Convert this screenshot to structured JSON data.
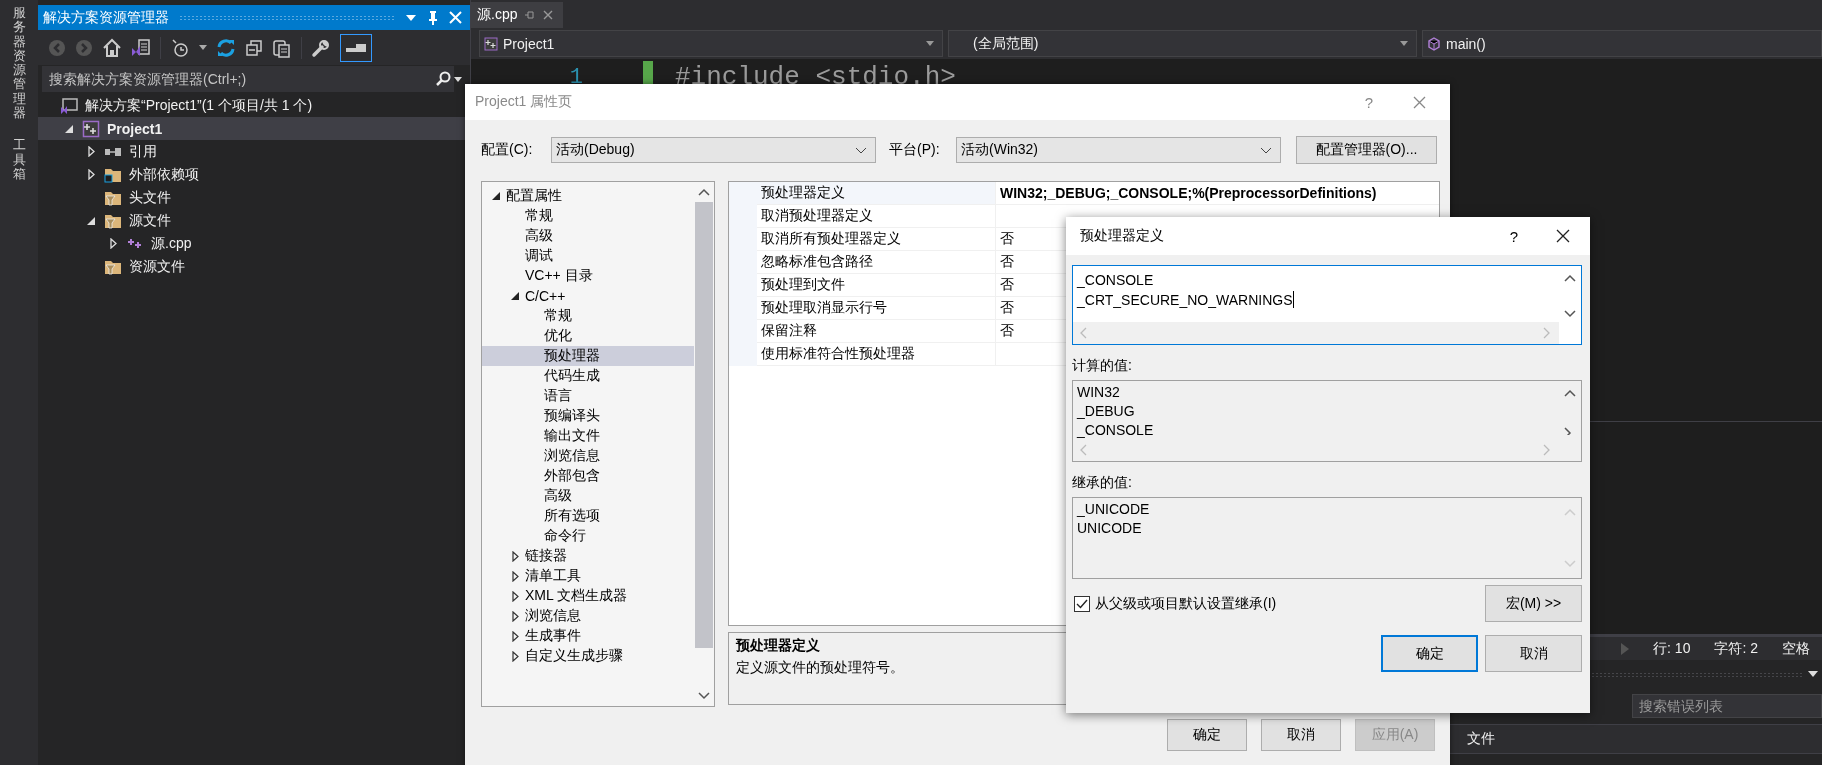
{
  "side_tabs": [
    {
      "label": "服务器资源管理器"
    },
    {
      "label": "工具箱"
    }
  ],
  "solution_explorer": {
    "title": "解决方案资源管理器",
    "preview_toggle": {
      "on": true
    },
    "search": {
      "placeholder": "搜索解决方案资源管理器(Ctrl+;)"
    },
    "tree": [
      {
        "label": "解决方案“Project1”(1 个项目/共 1 个)",
        "kind": "solution",
        "selected": false,
        "children": [
          {
            "label": "Project1",
            "kind": "project",
            "expanded": true,
            "selected": true,
            "children": [
              {
                "label": "引用",
                "kind": "references",
                "expanded": false,
                "selected": false
              },
              {
                "label": "外部依赖项",
                "kind": "external",
                "expanded": false,
                "selected": false
              },
              {
                "label": "头文件",
                "kind": "filter",
                "selected": false
              },
              {
                "label": "源文件",
                "kind": "filter",
                "expanded": true,
                "selected": false,
                "children": [
                  {
                    "label": "源.cpp",
                    "kind": "cpp",
                    "expanded": false,
                    "selected": false
                  }
                ]
              },
              {
                "label": "资源文件",
                "kind": "filter",
                "selected": false
              }
            ]
          }
        ]
      }
    ]
  },
  "editor": {
    "tab": {
      "label": "源.cpp",
      "selected": true
    },
    "nav": [
      {
        "label": "Project1",
        "kind": "project"
      },
      {
        "label": "(全局范围)",
        "kind": "scope"
      },
      {
        "label": "main()",
        "kind": "function"
      }
    ],
    "code": [
      {
        "number": "1",
        "text": "#include <stdio.h>"
      }
    ],
    "status_bar": [
      "行: 10",
      "字符: 2",
      "空格"
    ],
    "error_list": {
      "search": {
        "placeholder": "搜索错误列表"
      },
      "columns": [
        "文件"
      ]
    }
  },
  "properties": {
    "title": "Project1 属性页",
    "help": "?",
    "configuration": {
      "label": "配置(C):",
      "value": "活动(Debug)"
    },
    "platform": {
      "label": "平台(P):",
      "value": "活动(Win32)"
    },
    "manager_button": "配置管理器(O)...",
    "tree": [
      {
        "label": "配置属性",
        "expanded": true,
        "selected": false,
        "children": [
          {
            "label": "常规",
            "selected": false
          },
          {
            "label": "高级",
            "selected": false
          },
          {
            "label": "调试",
            "selected": false
          },
          {
            "label": "VC++ 目录",
            "selected": false
          },
          {
            "label": "C/C++",
            "expanded": true,
            "selected": false,
            "children": [
              {
                "label": "常规",
                "selected": false
              },
              {
                "label": "优化",
                "selected": false
              },
              {
                "label": "预处理器",
                "selected": true
              },
              {
                "label": "代码生成",
                "selected": false
              },
              {
                "label": "语言",
                "selected": false
              },
              {
                "label": "预编译头",
                "selected": false
              },
              {
                "label": "输出文件",
                "selected": false
              },
              {
                "label": "浏览信息",
                "selected": false
              },
              {
                "label": "外部包含",
                "selected": false
              },
              {
                "label": "高级",
                "selected": false
              },
              {
                "label": "所有选项",
                "selected": false
              },
              {
                "label": "命令行",
                "selected": false
              }
            ]
          },
          {
            "label": "链接器",
            "expanded": false,
            "selected": false
          },
          {
            "label": "清单工具",
            "expanded": false,
            "selected": false
          },
          {
            "label": "XML 文档生成器",
            "expanded": false,
            "selected": false
          },
          {
            "label": "浏览信息",
            "expanded": false,
            "selected": false
          },
          {
            "label": "生成事件",
            "expanded": false,
            "selected": false
          },
          {
            "label": "自定义生成步骤",
            "expanded": false,
            "selected": false
          }
        ]
      }
    ],
    "grid": [
      {
        "name": "预处理器定义",
        "value": "WIN32;_DEBUG;_CONSOLE;%(PreprocessorDefinitions)",
        "modified": true,
        "selected": true
      },
      {
        "name": "取消预处理器定义",
        "selected": false
      },
      {
        "name": "取消所有预处理器定义",
        "value": "否",
        "modified": false,
        "selected": false
      },
      {
        "name": "忽略标准包含路径",
        "value": "否",
        "modified": false,
        "selected": false
      },
      {
        "name": "预处理到文件",
        "value": "否",
        "modified": false,
        "selected": false
      },
      {
        "name": "预处理取消显示行号",
        "value": "否",
        "modified": false,
        "selected": false
      },
      {
        "name": "保留注释",
        "value": "否",
        "modified": false,
        "selected": false
      },
      {
        "name": "使用标准符合性预处理器",
        "selected": false
      }
    ],
    "description": {
      "title": "预处理器定义",
      "text": "定义源文件的预处理符号。"
    },
    "buttons": [
      {
        "label": "确定",
        "disabled": false
      },
      {
        "label": "取消",
        "disabled": false
      },
      {
        "label": "应用(A)",
        "disabled": true
      }
    ]
  },
  "define_dialog": {
    "title": "预处理器定义",
    "help": "?",
    "value_lines": [
      "_CONSOLE",
      "_CRT_SECURE_NO_WARNINGS"
    ],
    "computed": {
      "label": "计算的值:",
      "lines": [
        "WIN32",
        "_DEBUG",
        "_CONSOLE"
      ]
    },
    "inherited": {
      "label": "继承的值:",
      "lines": [
        "_UNICODE",
        "UNICODE"
      ]
    },
    "inherit": {
      "label": "从父级或项目默认设置继承(I)",
      "checked": true
    },
    "macros_button": "宏(M) >>",
    "buttons": [
      {
        "label": "确定",
        "default": true
      },
      {
        "label": "取消",
        "default": false
      }
    ]
  }
}
